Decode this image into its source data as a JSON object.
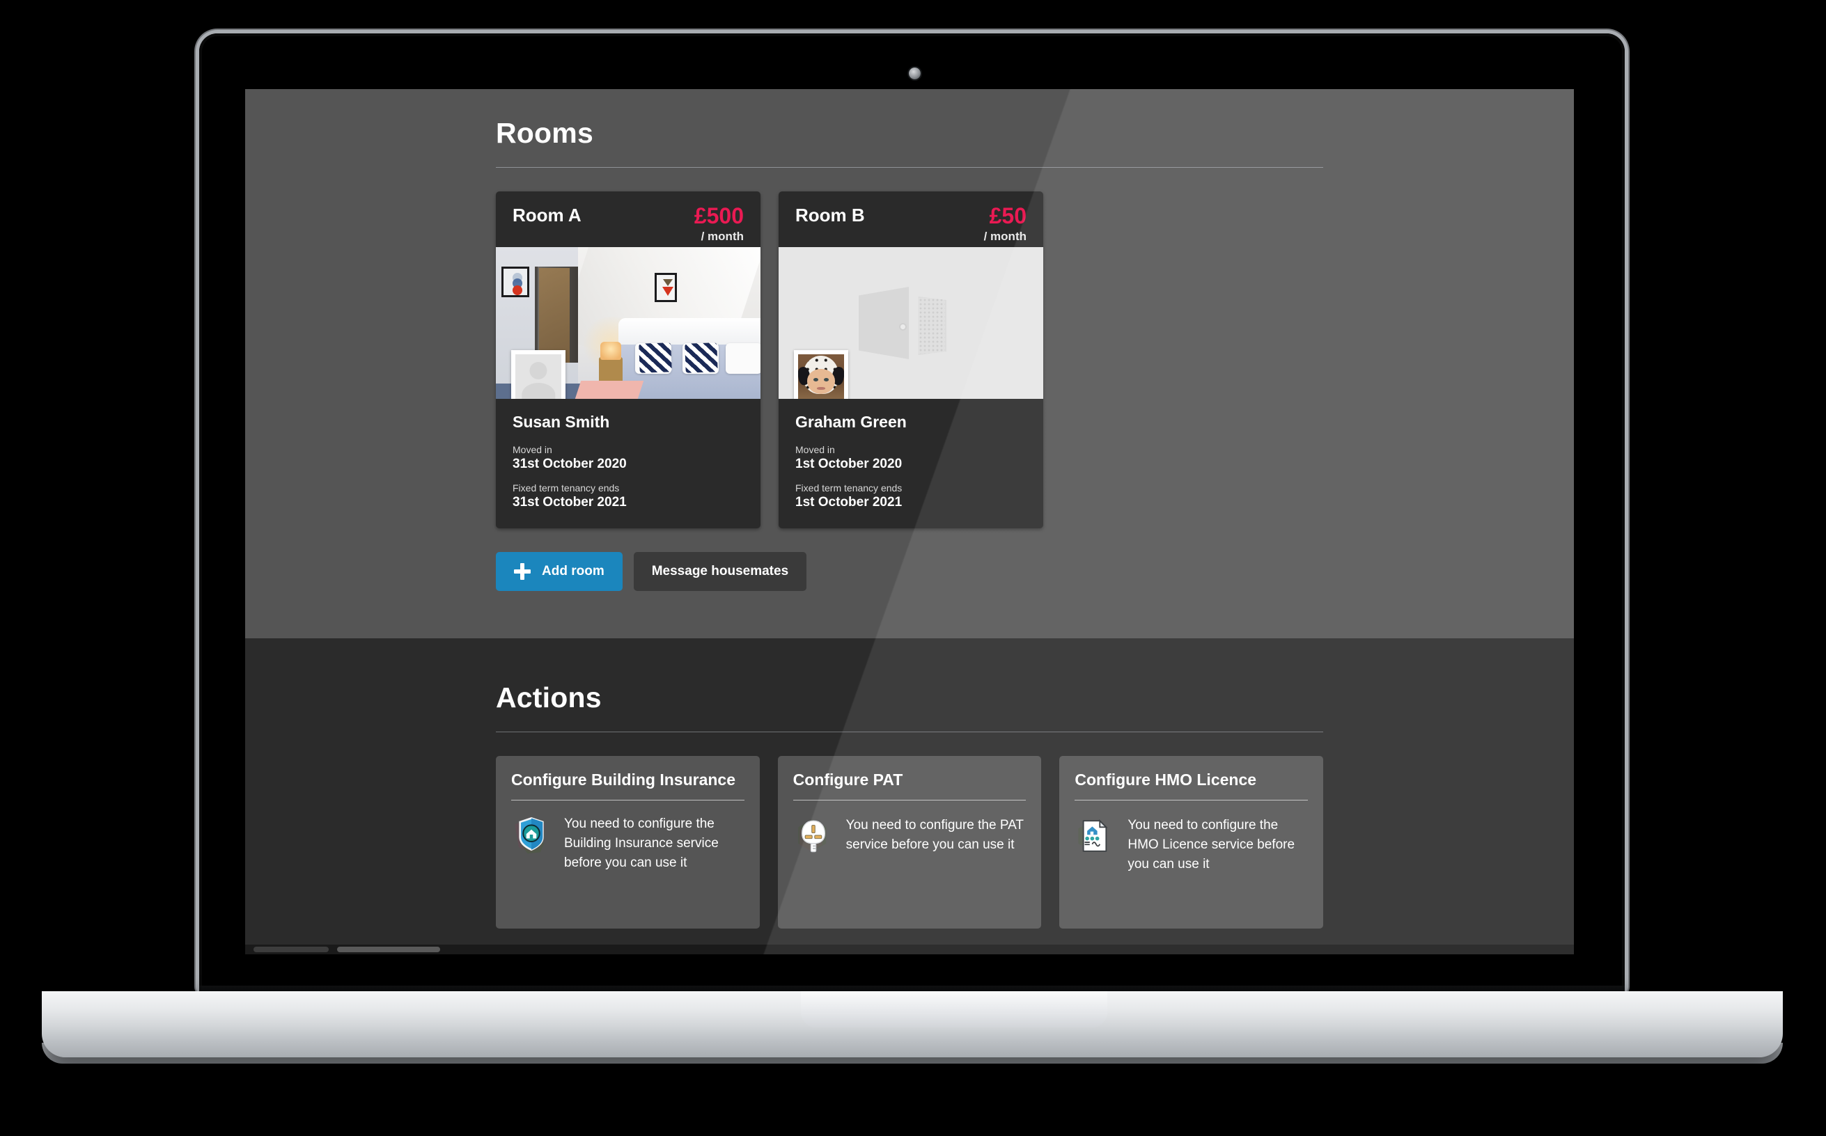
{
  "rooms_section": {
    "title": "Rooms",
    "rooms": [
      {
        "name": "Room A",
        "price": "£500",
        "price_period": "/ month",
        "photo_type": "bedroom-photo",
        "avatar_type": "avatar-placeholder",
        "tenant_name": "Susan Smith",
        "moved_in_label": "Moved in",
        "moved_in_value": "31st October 2020",
        "tenancy_end_label": "Fixed term tenancy ends",
        "tenancy_end_value": "31st October 2021"
      },
      {
        "name": "Room B",
        "price": "£50",
        "price_period": "/ month",
        "photo_type": "door-placeholder",
        "avatar_type": "avatar-photo",
        "tenant_name": "Graham Green",
        "moved_in_label": "Moved in",
        "moved_in_value": "1st October 2020",
        "tenancy_end_label": "Fixed term tenancy ends",
        "tenancy_end_value": "1st October 2021"
      }
    ],
    "add_room_label": "Add room",
    "message_housemates_label": "Message housemates"
  },
  "actions_section": {
    "title": "Actions",
    "cards": [
      {
        "title": "Configure Building Insurance",
        "description": "You need to configure the Building Insurance service before you can use it",
        "icon": "shield-house-icon"
      },
      {
        "title": "Configure PAT",
        "description": "You need to configure the PAT service before you can use it",
        "icon": "uk-plug-icon"
      },
      {
        "title": "Configure HMO Licence",
        "description": "You need to configure the HMO Licence service before you can use it",
        "icon": "licence-document-icon"
      }
    ]
  },
  "colors": {
    "accent_price": "#ea1a53",
    "primary_button": "#1b86bd",
    "secondary_button": "#3a3a3a",
    "light_section_bg": "#555555",
    "dark_section_bg": "#2b2b2b",
    "room_card_bg": "#2a2a2a"
  },
  "device": {
    "type": "laptop-mockup"
  }
}
